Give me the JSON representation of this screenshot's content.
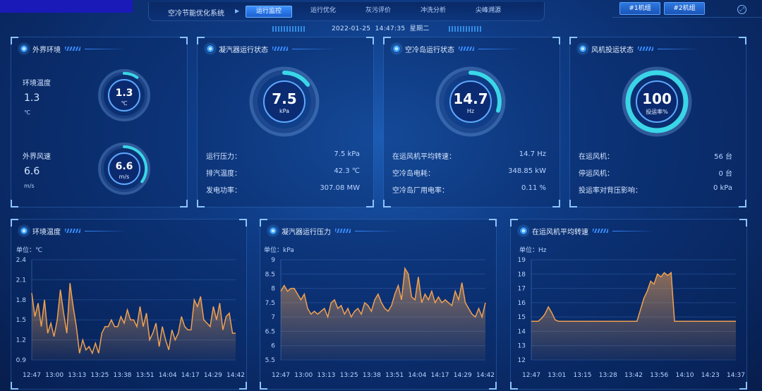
{
  "header": {
    "system_title": "空冷节能优化系统",
    "tabs": [
      {
        "label": "运行监控",
        "active": true
      },
      {
        "label": "运行优化",
        "active": false
      },
      {
        "label": "灰污评价",
        "active": false
      },
      {
        "label": "冲洗分析",
        "active": false
      },
      {
        "label": "尖峰溯源",
        "active": false
      }
    ],
    "date": "2022-01-25",
    "time": "14:47:35",
    "weekday": "星期二",
    "groups": [
      "#1机组",
      "#2机组"
    ]
  },
  "panels": {
    "env": {
      "title": "外界环境",
      "temp_label": "环境温度",
      "temp_value": "1.3",
      "temp_unit": "℃",
      "wind_label": "外界风速",
      "wind_value": "6.6",
      "wind_unit": "m/s",
      "gauge_temp": {
        "value": "1.3",
        "unit": "℃",
        "fraction": 0.1
      },
      "gauge_wind": {
        "value": "6.6",
        "unit": "m/s",
        "fraction": 0.35
      }
    },
    "condenser": {
      "title": "凝汽器运行状态",
      "gauge": {
        "value": "7.5",
        "unit": "kPa",
        "fraction": 0.15
      },
      "rows": [
        {
          "label": "运行压力：",
          "value": "7.5 kPa"
        },
        {
          "label": "排汽温度：",
          "value": "42.3 ℃"
        },
        {
          "label": "发电功率：",
          "value": "307.08 MW"
        }
      ]
    },
    "island": {
      "title": "空冷岛运行状态",
      "gauge": {
        "value": "14.7",
        "unit": "Hz",
        "fraction": 0.3
      },
      "rows": [
        {
          "label": "在运风机平均转速：",
          "value": "14.7 Hz"
        },
        {
          "label": "空冷岛电耗：",
          "value": "348.85 kW"
        },
        {
          "label": "空冷岛厂用电率：",
          "value": "0.11 %"
        }
      ]
    },
    "fan": {
      "title": "风机投运状态",
      "gauge": {
        "value": "100",
        "unit": "投运率%",
        "fraction": 1.0
      },
      "rows": [
        {
          "label": "在运风机：",
          "value": "56 台"
        },
        {
          "label": "停运风机：",
          "value": "0 台"
        },
        {
          "label": "投运率对背压影响：",
          "value": "0 kPa"
        }
      ]
    }
  },
  "chart_data": [
    {
      "type": "area",
      "title": "环境温度",
      "unit_label": "单位：℃",
      "x_ticks": [
        "12:47",
        "13:00",
        "13:13",
        "13:25",
        "13:38",
        "13:51",
        "14:04",
        "14:17",
        "14:29",
        "14:42"
      ],
      "y_ticks": [
        "2.4",
        "2.1",
        "1.8",
        "1.5",
        "1.2",
        "0.9"
      ],
      "ylim": [
        0.9,
        2.4
      ],
      "values": [
        1.9,
        1.55,
        1.75,
        1.4,
        1.8,
        1.3,
        1.45,
        1.25,
        1.5,
        1.95,
        1.6,
        1.3,
        2.05,
        1.7,
        1.4,
        1.0,
        1.2,
        1.05,
        1.1,
        1.0,
        1.15,
        1.0,
        1.3,
        1.4,
        1.4,
        1.5,
        1.4,
        1.4,
        1.55,
        1.45,
        1.65,
        1.5,
        1.5,
        1.4,
        1.7,
        1.4,
        1.6,
        1.2,
        1.3,
        1.45,
        1.1,
        1.4,
        1.2,
        1.05,
        1.35,
        1.2,
        1.3,
        1.55,
        1.4,
        1.35,
        1.35,
        1.8,
        1.7,
        1.85,
        1.5,
        1.45,
        1.4,
        1.7,
        1.5,
        1.75,
        1.35,
        1.55,
        1.6,
        1.3,
        1.3
      ],
      "color": "#f0a050"
    },
    {
      "type": "area",
      "title": "凝汽器运行压力",
      "unit_label": "单位：kPa",
      "x_ticks": [
        "12:47",
        "13:00",
        "13:13",
        "13:25",
        "13:38",
        "13:51",
        "14:04",
        "14:17",
        "14:29",
        "14:42"
      ],
      "y_ticks": [
        "9",
        "8.5",
        "8",
        "7.5",
        "7",
        "6.5",
        "6",
        "5.5"
      ],
      "ylim": [
        5.5,
        9
      ],
      "values": [
        7.9,
        8.1,
        7.9,
        8.0,
        8.0,
        7.8,
        7.6,
        7.8,
        7.3,
        7.1,
        7.2,
        7.1,
        7.2,
        7.3,
        7.0,
        7.5,
        7.6,
        7.3,
        7.4,
        7.1,
        7.3,
        7.0,
        7.2,
        7.3,
        7.1,
        7.5,
        7.4,
        7.2,
        7.6,
        7.8,
        7.5,
        7.3,
        7.2,
        7.4,
        7.8,
        8.1,
        7.6,
        8.7,
        8.5,
        7.7,
        7.6,
        8.4,
        7.5,
        7.8,
        7.6,
        7.9,
        7.5,
        7.7,
        7.5,
        7.6,
        7.5,
        7.4,
        7.9,
        7.6,
        8.2,
        7.5,
        7.3,
        7.1,
        7.0,
        7.3,
        7.0,
        7.5
      ],
      "color": "#f0a050"
    },
    {
      "type": "area",
      "title": "在运风机平均转速",
      "unit_label": "单位：Hz",
      "x_ticks": [
        "12:47",
        "13:01",
        "13:15",
        "13:28",
        "13:42",
        "13:56",
        "14:10",
        "14:23",
        "14:37"
      ],
      "y_ticks": [
        "19",
        "18",
        "17",
        "16",
        "15",
        "14",
        "13",
        "12"
      ],
      "ylim": [
        12,
        19
      ],
      "values": [
        14.7,
        14.7,
        14.7,
        14.9,
        15.2,
        15.7,
        15.3,
        14.8,
        14.7,
        14.7,
        14.7,
        14.7,
        14.7,
        14.7,
        14.7,
        14.7,
        14.7,
        14.7,
        14.7,
        14.7,
        14.7,
        14.7,
        14.7,
        14.7,
        14.7,
        14.7,
        14.7,
        14.7,
        14.7,
        14.7,
        14.7,
        14.7,
        15.5,
        16.3,
        16.8,
        17.5,
        17.3,
        18.0,
        17.8,
        18.1,
        17.9,
        18.1,
        14.7,
        14.7,
        14.7,
        14.7,
        14.7,
        14.7,
        14.7,
        14.7,
        14.7,
        14.7,
        14.7,
        14.7,
        14.7,
        14.7,
        14.7,
        14.7,
        14.7,
        14.7,
        14.7
      ],
      "color": "#f0a050"
    }
  ]
}
